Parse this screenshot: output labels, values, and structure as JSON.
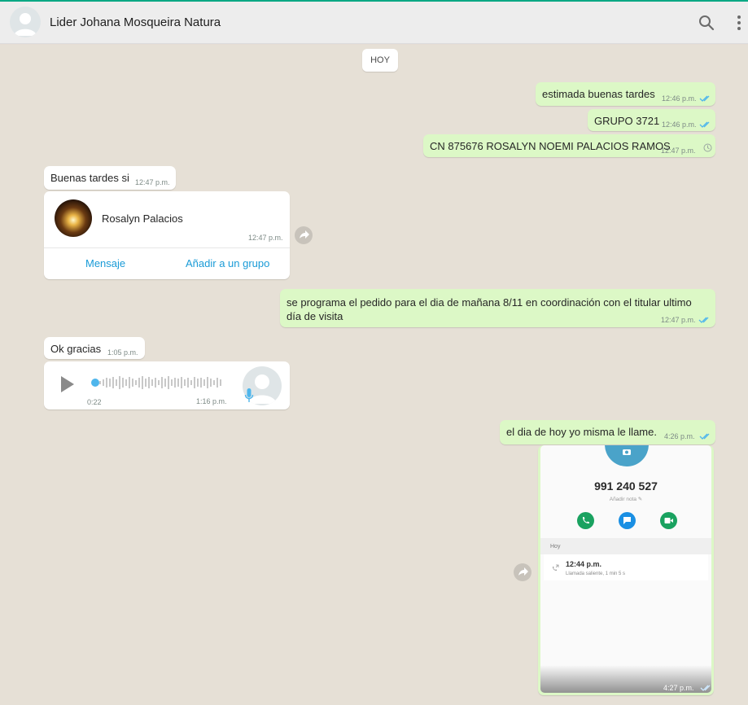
{
  "header": {
    "contact_name": "Lider Johana Mosqueira Natura",
    "avatar_icon": "default-avatar-icon",
    "search_icon": "search-icon",
    "menu_icon": "more-vertical-icon"
  },
  "chat": {
    "date_chip": "HOY",
    "messages": [
      {
        "text": "estimada buenas tardes",
        "time": "12:46 p.m.",
        "status": "read"
      },
      {
        "text": "GRUPO 3721",
        "time": "12:46 p.m.",
        "status": "read"
      },
      {
        "text": "CN 875676 ROSALYN NOEMI PALACIOS RAMOS",
        "time": "12:47 p.m.",
        "status": "sending"
      },
      {
        "text": "Buenas tardes si",
        "time": "12:47 p.m."
      },
      {
        "text_line1": "se programa el pedido para el dia de mañana 8/11 en coordinación con el titular ultimo",
        "text_line2": "día de visita",
        "time": "12:47 p.m.",
        "status": "read"
      },
      {
        "text": "Ok gracias",
        "time": "1:05 p.m."
      },
      {
        "text": "el dia de hoy yo misma le llame.",
        "time": "4:26 p.m.",
        "status": "read"
      }
    ],
    "contact_card": {
      "name": "Rosalyn Palacios",
      "time": "12:47 p.m.",
      "action_message": "Mensaje",
      "action_add_group": "Añadir a un grupo"
    },
    "voice_note": {
      "duration": "0:22",
      "time": "1:16 p.m.",
      "progress": 0.0
    },
    "image_message": {
      "phone": "991 240 527",
      "add_note": "Añadir nota",
      "section": "Hoy",
      "call_time": "12:44 p.m.",
      "call_desc": "Llamada saliente, 1 min 5 s",
      "time": "4:27 p.m."
    }
  },
  "colors": {
    "accent": "#06a884",
    "outgoing_bubble": "#dcf8c6",
    "incoming_bubble": "#ffffff",
    "read_ticks": "#4fb6ec",
    "link": "#1a9bd7",
    "background": "#e6e0d6"
  }
}
